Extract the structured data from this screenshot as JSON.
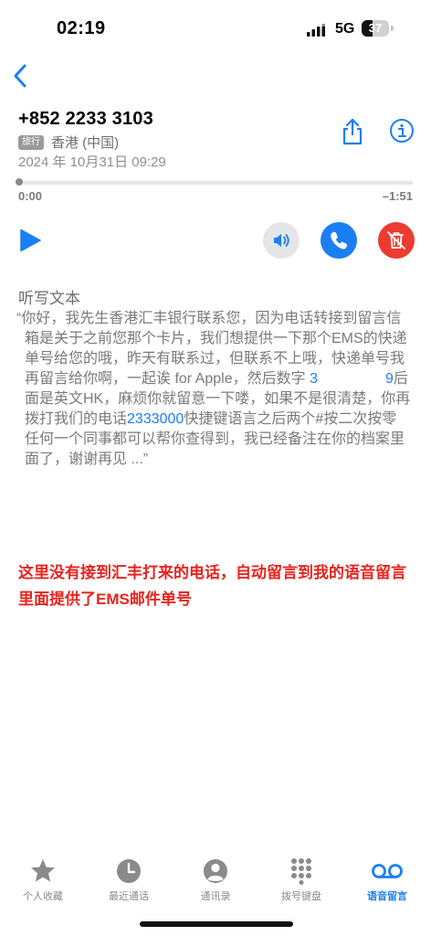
{
  "status_bar": {
    "time": "02:19",
    "network": "5G",
    "battery": "37"
  },
  "voicemail": {
    "phone_number": "+852 2233 3103",
    "tag": "旅行",
    "region": "香港 (中国)",
    "datetime": "2024 年 10月31日 09:29",
    "elapsed": "0:00",
    "remaining": "–1:51",
    "playback_progress": 0
  },
  "transcript": {
    "title": "听写文本",
    "part1": "“你好，我先生香港汇丰银行联系您，因为电话转接到留言信箱是关于之前您那个卡片，我们想提供一下那个EMS的快递单号给您的哦，昨天有联系过，但联系不上哦，快递单号我再留言给你啊，一起诶 for Apple，然后数字",
    "link1_start": "3",
    "link1_end": "9",
    "part2": "后面是英文HK，麻烦你就留意一下喽，如果不是很清楚，你再拨打我们的电话",
    "link2": "2333000",
    "part3": "快捷键语言之后两个#按二次按零任何一个同事都可以帮你查得到，我已经备注在你的档案里面了，谢谢再见 ...”"
  },
  "annotation": "这里没有接到汇丰打来的电话，自动留言到我的语音留言里面提供了EMS邮件单号",
  "tabs": [
    {
      "label": "个人收藏",
      "icon": "star-icon"
    },
    {
      "label": "最近通话",
      "icon": "clock-icon"
    },
    {
      "label": "通讯录",
      "icon": "contacts-icon"
    },
    {
      "label": "拨号键盘",
      "icon": "keypad-icon"
    },
    {
      "label": "语音留言",
      "icon": "voicemail-icon",
      "active": true
    }
  ],
  "colors": {
    "accent": "#1a7ff2",
    "danger": "#ee3b32",
    "annotation": "#e8231e"
  }
}
